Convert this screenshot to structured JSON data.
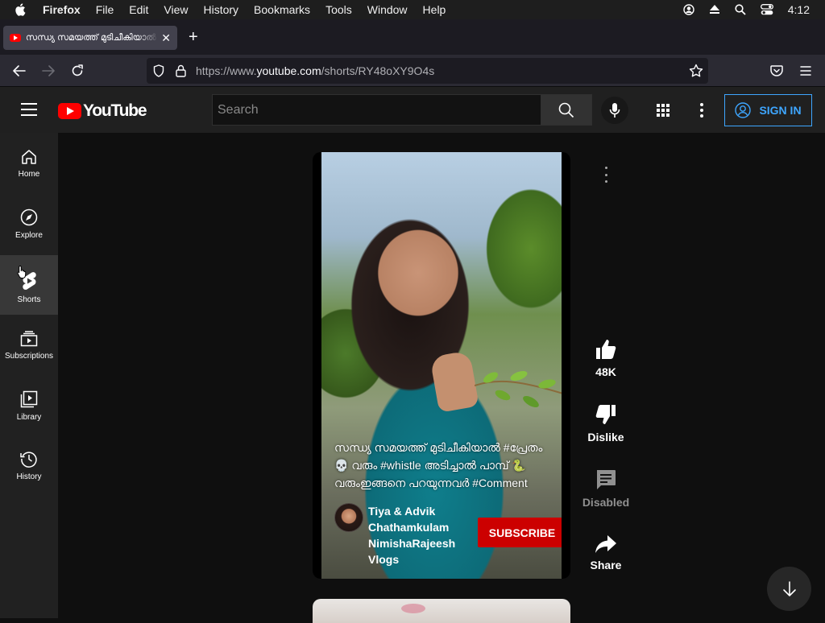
{
  "menubar": {
    "app_name": "Firefox",
    "items": [
      "File",
      "Edit",
      "View",
      "History",
      "Bookmarks",
      "Tools",
      "Window",
      "Help"
    ],
    "clock": "4:12"
  },
  "browser": {
    "tab_title": "സന്ധ്യ സമയത്ത് മുടിചീകിയാൽ #പ്രേതം",
    "url_prefix": "https://www.",
    "url_domain": "youtube.com",
    "url_path": "/shorts/RY48oXY9O4s"
  },
  "youtube": {
    "logo_text": "YouTube",
    "search_placeholder": "Search",
    "sign_in_label": "SIGN IN",
    "sidebar": [
      {
        "label": "Home",
        "icon": "home-icon"
      },
      {
        "label": "Explore",
        "icon": "compass-icon"
      },
      {
        "label": "Shorts",
        "icon": "shorts-icon",
        "active": true
      },
      {
        "label": "Subscriptions",
        "icon": "subscriptions-icon"
      },
      {
        "label": "Library",
        "icon": "library-icon"
      },
      {
        "label": "History",
        "icon": "history-icon"
      }
    ],
    "short": {
      "caption_line1": "സന്ധ്യ സമയത്ത് മുടിചീകിയാൽ #പ്രേതം",
      "caption_line2": "💀 വരും #whistle അടിച്ചാൽ പാമ്പ് 🐍",
      "caption_line3": "വരുംഇങ്ങനെ പറയുന്നവർ #Comment",
      "channel_name": "Tiya & Advik Chathamkulam NimishaRajeesh Vlogs",
      "subscribe_label": "SUBSCRIBE"
    },
    "actions": {
      "like_count": "48K",
      "dislike_label": "Dislike",
      "comments_label": "Disabled",
      "share_label": "Share"
    }
  },
  "colors": {
    "accent_blue": "#3ea6ff",
    "youtube_red": "#ff0000",
    "subscribe_red": "#cc0000"
  }
}
